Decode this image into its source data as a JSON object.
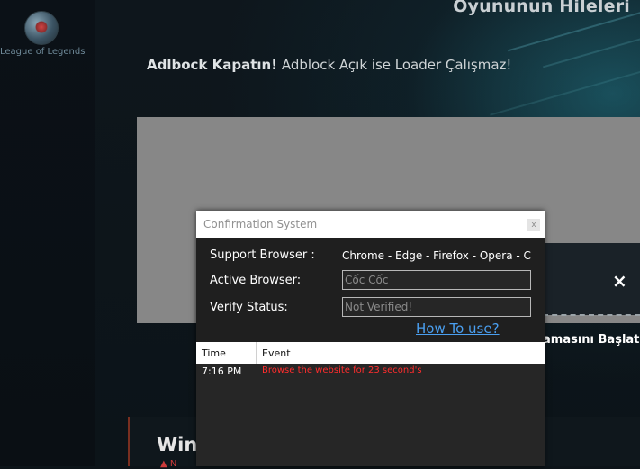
{
  "sidebar": {
    "label": "League of Legends"
  },
  "header": {
    "title": "Oyununun Hileleri"
  },
  "notice": {
    "bold": "Adlbock Kapatın!",
    "text": " Adblock Açık ise Loader Çalışmaz!"
  },
  "background_panel": {
    "close_symbol": "×",
    "start_text": "amasını Başlatın",
    "lower_title": "Windows",
    "lower_sub": "▲ N"
  },
  "modal": {
    "title": "Confirmation System",
    "close_symbol": "x",
    "support_label": "Support Browser :",
    "support_value": "Chrome - Edge - Firefox - Opera - Coc",
    "active_label": "Active Browser:",
    "active_value": "Cốc Cốc",
    "verify_label": "Verify Status:",
    "verify_value": "Not Verified!",
    "howto_label": "How To use?",
    "table": {
      "col_time": "Time",
      "col_event": "Event",
      "rows": [
        {
          "time": "7:16 PM",
          "event": "Browse the website for 23 second's"
        }
      ]
    }
  },
  "colors": {
    "accent_link": "#4a9ff0",
    "event_error": "#ff2d2d",
    "modal_bg": "#262626"
  }
}
